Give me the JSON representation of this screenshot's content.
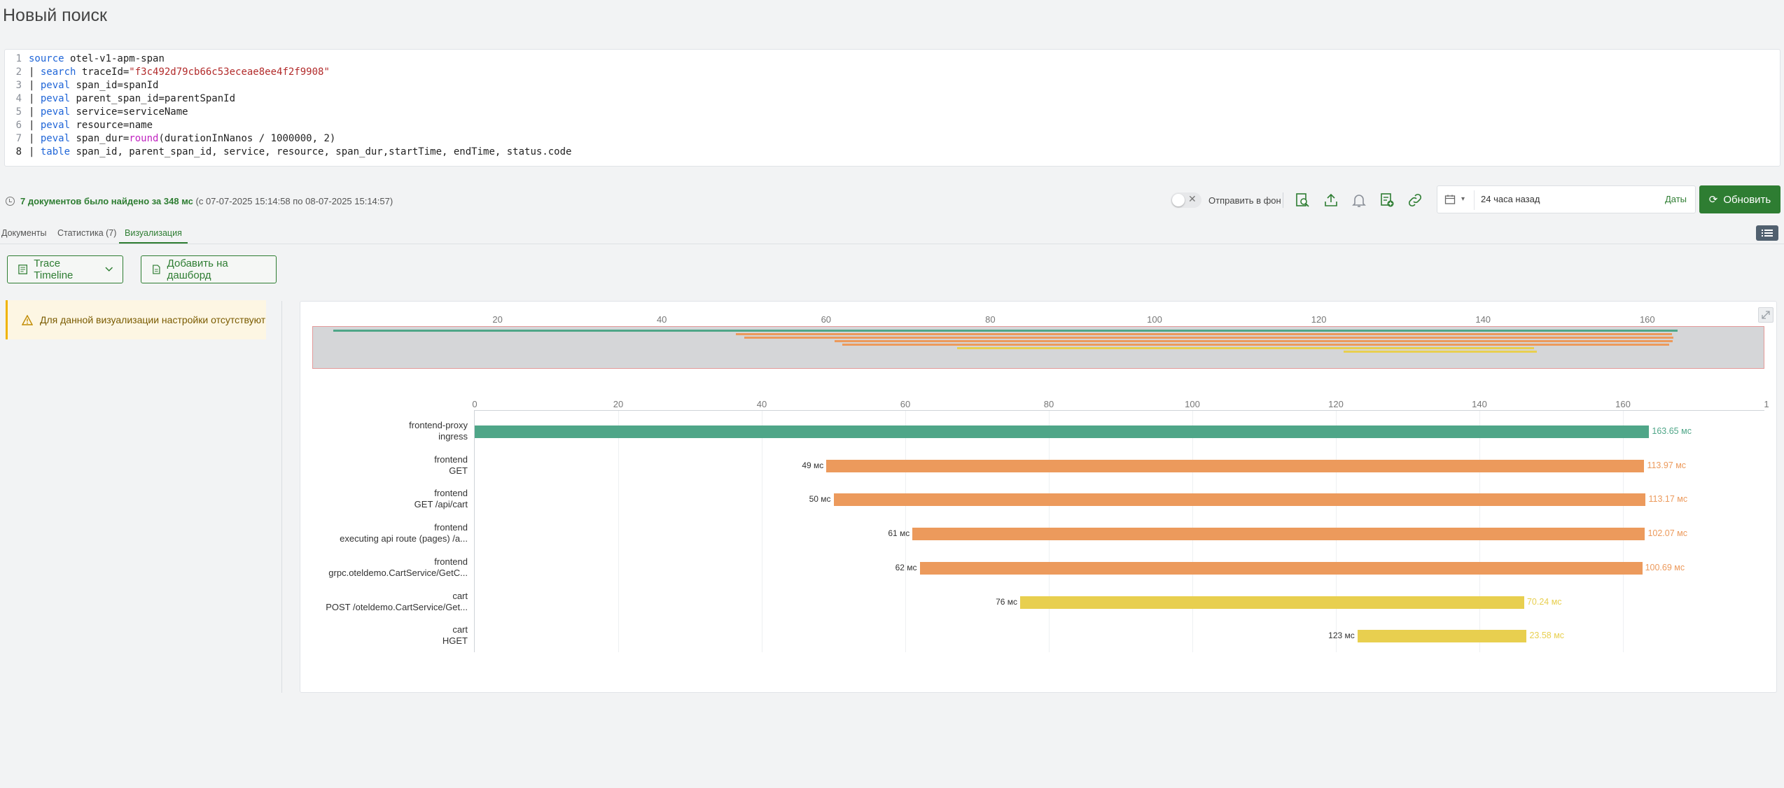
{
  "page": {
    "title": "Новый поиск"
  },
  "query": {
    "lines": [
      {
        "num": "1",
        "parts": [
          {
            "t": "source",
            "c": "kw"
          },
          {
            "t": " otel-v1-apm-span",
            "c": "code-text"
          }
        ]
      },
      {
        "num": "2",
        "parts": [
          {
            "t": "| ",
            "c": "code-text"
          },
          {
            "t": "search",
            "c": "kw"
          },
          {
            "t": " traceId=",
            "c": "code-text"
          },
          {
            "t": "\"f3c492d79cb66c53eceae8ee4f2f9908\"",
            "c": "str"
          }
        ]
      },
      {
        "num": "3",
        "parts": [
          {
            "t": "| ",
            "c": "code-text"
          },
          {
            "t": "peval",
            "c": "kw"
          },
          {
            "t": " span_id=spanId",
            "c": "code-text"
          }
        ]
      },
      {
        "num": "4",
        "parts": [
          {
            "t": "| ",
            "c": "code-text"
          },
          {
            "t": "peval",
            "c": "kw"
          },
          {
            "t": " parent_span_id=parentSpanId",
            "c": "code-text"
          }
        ]
      },
      {
        "num": "5",
        "parts": [
          {
            "t": "| ",
            "c": "code-text"
          },
          {
            "t": "peval",
            "c": "kw"
          },
          {
            "t": " service=serviceName",
            "c": "code-text"
          }
        ]
      },
      {
        "num": "6",
        "parts": [
          {
            "t": "| ",
            "c": "code-text"
          },
          {
            "t": "peval",
            "c": "kw"
          },
          {
            "t": " resource=name",
            "c": "code-text"
          }
        ]
      },
      {
        "num": "7",
        "parts": [
          {
            "t": "| ",
            "c": "code-text"
          },
          {
            "t": "peval",
            "c": "kw"
          },
          {
            "t": " span_dur=",
            "c": "code-text"
          },
          {
            "t": "round",
            "c": "fn"
          },
          {
            "t": "(durationInNanos / 1000000, 2)",
            "c": "code-text"
          }
        ]
      },
      {
        "num": "8",
        "parts": [
          {
            "t": "| ",
            "c": "code-text"
          },
          {
            "t": "table",
            "c": "kw"
          },
          {
            "t": " span_id, parent_span_id, service, resource, span_dur,startTime, endTime, status.code",
            "c": "code-text"
          }
        ]
      }
    ]
  },
  "results": {
    "found_strong": "7 документов было найдено за 348 мс",
    "found_range": " (с 07-07-2025 15:14:58 по 08-07-2025 15:14:57)"
  },
  "toolbar": {
    "background_label": "Отправить в фон",
    "time_value": "24 часа назад",
    "dates_link": "Даты",
    "refresh_label": "Обновить"
  },
  "tabs": [
    {
      "label": "Документы"
    },
    {
      "label": "Статистика (7)"
    },
    {
      "label": "Визуализация"
    }
  ],
  "viz": {
    "type_label": "Trace Timeline",
    "add_dashboard_label": "Добавить на дашборд",
    "alert_text": "Для данной визуализации настройки отсутствуют"
  },
  "colors": {
    "accent": "#2e7d32",
    "ingress": "#4fa688",
    "frontend": "#ec9a5c",
    "cart": "#e8cf4f"
  },
  "chart_data": {
    "type": "bar",
    "x_ticks_overview": [
      "20",
      "40",
      "60",
      "80",
      "100",
      "120",
      "140",
      "160"
    ],
    "x_ticks_main": [
      "0",
      "20",
      "40",
      "60",
      "80",
      "100",
      "120",
      "140",
      "160",
      "1"
    ],
    "xlim": [
      0,
      180
    ],
    "spans": [
      {
        "service": "frontend-proxy",
        "resource": "ingress",
        "start": 0,
        "duration": 163.65,
        "start_label": "",
        "duration_label": "163.65 мс",
        "color": "#4fa688"
      },
      {
        "service": "frontend",
        "resource": "GET",
        "start": 49,
        "duration": 113.97,
        "start_label": "49 мс",
        "duration_label": "113.97 мс",
        "color": "#ec9a5c"
      },
      {
        "service": "frontend",
        "resource": "GET /api/cart",
        "start": 50,
        "duration": 113.17,
        "start_label": "50 мс",
        "duration_label": "113.17 мс",
        "color": "#ec9a5c"
      },
      {
        "service": "frontend",
        "resource": "executing api route (pages) /a...",
        "start": 61,
        "duration": 102.07,
        "start_label": "61 мс",
        "duration_label": "102.07 мс",
        "color": "#ec9a5c"
      },
      {
        "service": "frontend",
        "resource": "grpc.oteldemo.CartService/GetC...",
        "start": 62,
        "duration": 100.69,
        "start_label": "62 мс",
        "duration_label": "100.69 мс",
        "color": "#ec9a5c"
      },
      {
        "service": "cart",
        "resource": "POST /oteldemo.CartService/Get...",
        "start": 76,
        "duration": 70.24,
        "start_label": "76 мс",
        "duration_label": "70.24 мс",
        "color": "#e8cf4f"
      },
      {
        "service": "cart",
        "resource": "HGET",
        "start": 123,
        "duration": 23.58,
        "start_label": "123 мс",
        "duration_label": "23.58 мс",
        "color": "#e8cf4f"
      }
    ]
  }
}
